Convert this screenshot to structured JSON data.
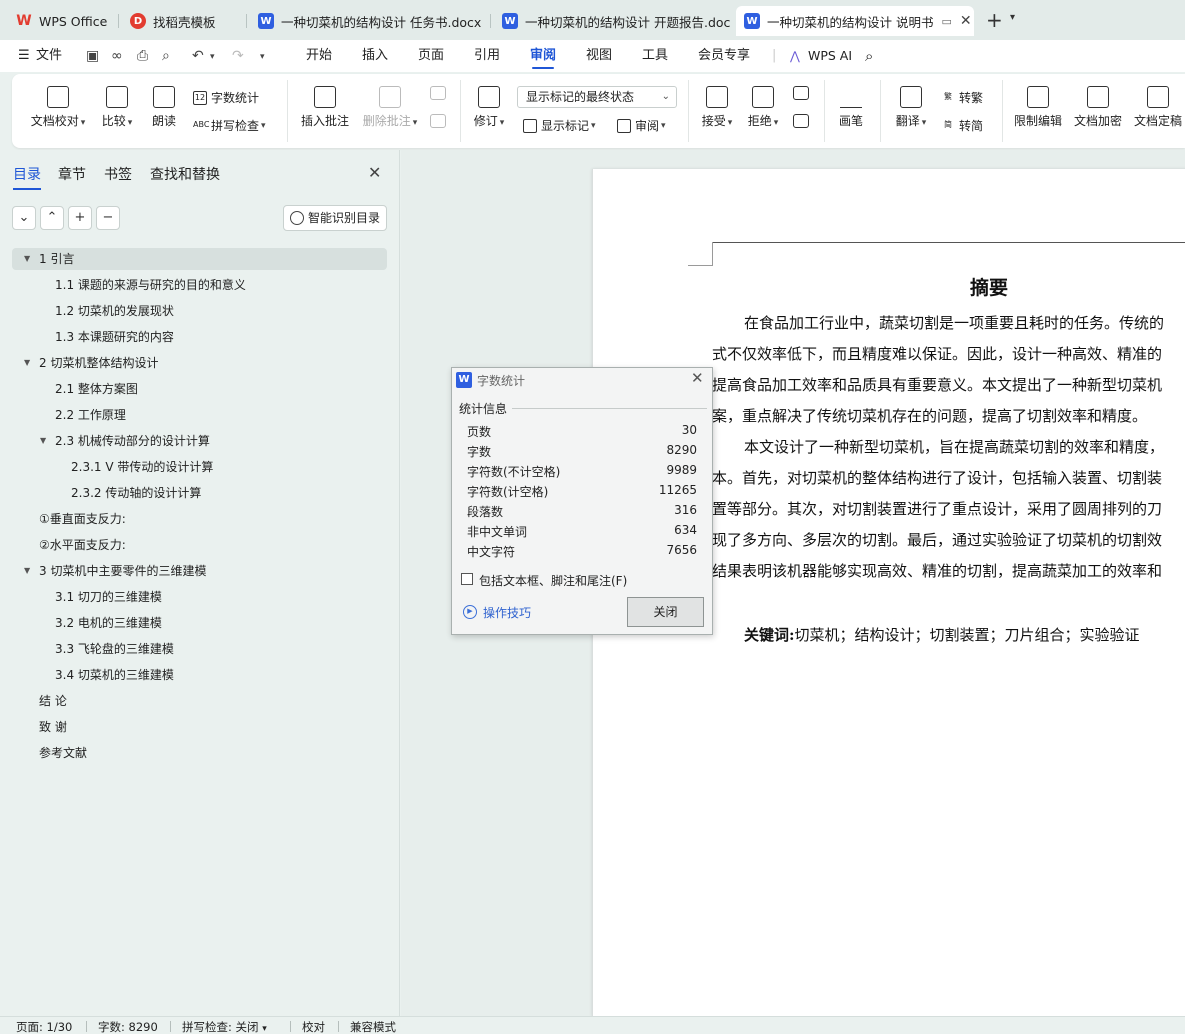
{
  "tabs": [
    {
      "label": "WPS Office",
      "icon": "wps-logo-icon"
    },
    {
      "label": "找稻壳模板",
      "icon": "docer-icon"
    },
    {
      "label": "一种切菜机的结构设计 任务书.docx",
      "icon": "word-doc-icon"
    },
    {
      "label": "一种切菜机的结构设计 开题报告.docx",
      "icon": "word-doc-icon"
    },
    {
      "label": "一种切菜机的结构设计 说明书",
      "icon": "word-doc-icon",
      "active": true
    }
  ],
  "menu": {
    "file": "文件",
    "items": [
      "开始",
      "插入",
      "页面",
      "引用",
      "审阅",
      "视图",
      "工具",
      "会员专享"
    ],
    "active": "审阅",
    "ai": "WPS AI"
  },
  "ribbon": {
    "doc_check": "文档校对",
    "compare": "比较",
    "read_aloud": "朗读",
    "word_count": "字数统计",
    "spell_check": "拼写检查",
    "insert_comment": "插入批注",
    "delete_comment": "删除批注",
    "revise": "修订",
    "markup_state": "显示标记的最终状态",
    "show_markup": "显示标记",
    "review": "审阅",
    "accept": "接受",
    "reject": "拒绝",
    "brush": "画笔",
    "translate": "翻译",
    "to_traditional": "转繁",
    "to_simplified": "转简",
    "restrict_edit": "限制编辑",
    "encrypt": "文档加密",
    "finalize": "文档定稿"
  },
  "sidebar": {
    "tabs": [
      "目录",
      "章节",
      "书签",
      "查找和替换"
    ],
    "active_tab": "目录",
    "smart_toc": "智能识别目录",
    "toc": [
      {
        "text": "1  引言",
        "level": 1,
        "expander": "down",
        "selected": true
      },
      {
        "text": "1.1  课题的来源与研究的目的和意义",
        "level": 2
      },
      {
        "text": "1.2  切菜机的发展现状",
        "level": 2
      },
      {
        "text": "1.3  本课题研究的内容",
        "level": 2
      },
      {
        "text": "2  切菜机整体结构设计",
        "level": 1,
        "expander": "down"
      },
      {
        "text": "2.1  整体方案图",
        "level": 2
      },
      {
        "text": "2.2  工作原理",
        "level": 2
      },
      {
        "text": "2.3  机械传动部分的设计计算",
        "level": 2,
        "expander": "down"
      },
      {
        "text": "2.3.1 V 带传动的设计计算",
        "level": 3
      },
      {
        "text": "2.3.2 传动轴的设计计算",
        "level": 3
      },
      {
        "text": "①垂直面支反力:",
        "level": 1
      },
      {
        "text": "②水平面支反力:",
        "level": 1
      },
      {
        "text": "3  切菜机中主要零件的三维建模",
        "level": 1,
        "expander": "down"
      },
      {
        "text": "3.1 切刀的三维建模",
        "level": 2
      },
      {
        "text": "3.2 电机的三维建模",
        "level": 2
      },
      {
        "text": "3.3 飞轮盘的三维建模",
        "level": 2
      },
      {
        "text": "3.4 切菜机的三维建模",
        "level": 2
      },
      {
        "text": "结  论",
        "level": 1
      },
      {
        "text": "致  谢",
        "level": 1
      },
      {
        "text": "参考文献",
        "level": 1
      }
    ]
  },
  "document": {
    "title": "摘要",
    "lines": [
      "在食品加工行业中，蔬菜切割是一项重要且耗时的任务。传统的",
      "式不仅效率低下，而且精度难以保证。因此，设计一种高效、精准的",
      "提高食品加工效率和品质具有重要意义。本文提出了一种新型切菜机",
      "案，重点解决了传统切菜机存在的问题，提高了切割效率和精度。",
      "本文设计了一种新型切菜机，旨在提高蔬菜切割的效率和精度，",
      "本。首先，对切菜机的整体结构进行了设计，包括输入装置、切割装",
      "置等部分。其次，对切割装置进行了重点设计，采用了圆周排列的刀",
      "现了多方向、多层次的切割。最后，通过实验验证了切菜机的切割效",
      "结果表明该机器能够实现高效、精准的切割，提高蔬菜加工的效率和"
    ],
    "keywords_label": "关键词:",
    "keywords": "切菜机；结构设计；切割装置；刀片组合；实验验证"
  },
  "dialog": {
    "title": "字数统计",
    "group": "统计信息",
    "stats": [
      {
        "label": "页数",
        "value": "30"
      },
      {
        "label": "字数",
        "value": "8290"
      },
      {
        "label": "字符数(不计空格)",
        "value": "9989"
      },
      {
        "label": "字符数(计空格)",
        "value": "11265"
      },
      {
        "label": "段落数",
        "value": "316"
      },
      {
        "label": "非中文单词",
        "value": "634"
      },
      {
        "label": "中文字符",
        "value": "7656"
      }
    ],
    "include_label": "包括文本框、脚注和尾注(F)",
    "include_checked": false,
    "tips": "操作技巧",
    "close": "关闭"
  },
  "status": {
    "page": "页面: 1/30",
    "words": "字数: 8290",
    "spell": "拼写检查: 关闭",
    "proof": "校对",
    "compat": "兼容模式"
  },
  "colors": {
    "accent": "#1f56d6",
    "word_blue": "#2f5fe0",
    "wps_red": "#e23c30"
  }
}
